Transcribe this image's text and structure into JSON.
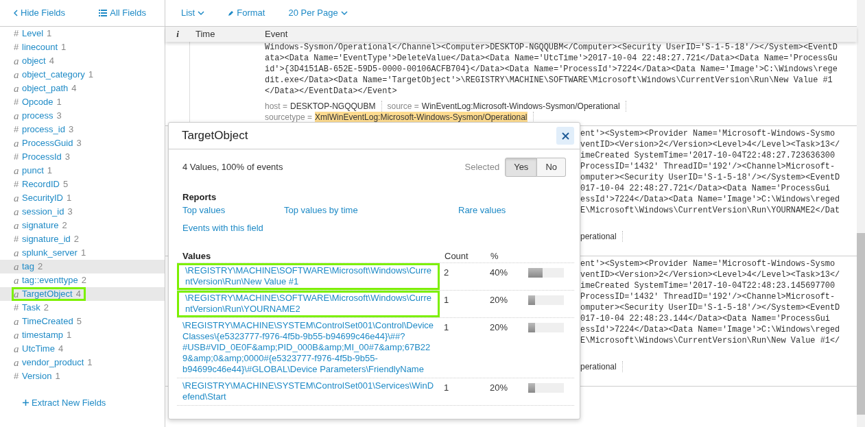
{
  "sidebar": {
    "hide_fields": "Hide Fields",
    "all_fields": "All Fields",
    "fields": [
      {
        "glyph": "#",
        "kind": "number",
        "name": "Level",
        "count": "1",
        "shaded": false,
        "outlined": false
      },
      {
        "glyph": "#",
        "kind": "number",
        "name": "linecount",
        "count": "1",
        "shaded": false,
        "outlined": false
      },
      {
        "glyph": "a",
        "kind": "string",
        "name": "object",
        "count": "4",
        "shaded": false,
        "outlined": false
      },
      {
        "glyph": "a",
        "kind": "string",
        "name": "object_category",
        "count": "1",
        "shaded": false,
        "outlined": false
      },
      {
        "glyph": "a",
        "kind": "string",
        "name": "object_path",
        "count": "4",
        "shaded": false,
        "outlined": false
      },
      {
        "glyph": "#",
        "kind": "number",
        "name": "Opcode",
        "count": "1",
        "shaded": false,
        "outlined": false
      },
      {
        "glyph": "a",
        "kind": "string",
        "name": "process",
        "count": "3",
        "shaded": false,
        "outlined": false
      },
      {
        "glyph": "#",
        "kind": "number",
        "name": "process_id",
        "count": "3",
        "shaded": false,
        "outlined": false
      },
      {
        "glyph": "a",
        "kind": "string",
        "name": "ProcessGuid",
        "count": "3",
        "shaded": false,
        "outlined": false
      },
      {
        "glyph": "#",
        "kind": "number",
        "name": "ProcessId",
        "count": "3",
        "shaded": false,
        "outlined": false
      },
      {
        "glyph": "a",
        "kind": "string",
        "name": "punct",
        "count": "1",
        "shaded": false,
        "outlined": false
      },
      {
        "glyph": "#",
        "kind": "number",
        "name": "RecordID",
        "count": "5",
        "shaded": false,
        "outlined": false
      },
      {
        "glyph": "a",
        "kind": "string",
        "name": "SecurityID",
        "count": "1",
        "shaded": false,
        "outlined": false
      },
      {
        "glyph": "a",
        "kind": "string",
        "name": "session_id",
        "count": "3",
        "shaded": false,
        "outlined": false
      },
      {
        "glyph": "a",
        "kind": "string",
        "name": "signature",
        "count": "2",
        "shaded": false,
        "outlined": false
      },
      {
        "glyph": "#",
        "kind": "number",
        "name": "signature_id",
        "count": "2",
        "shaded": false,
        "outlined": false
      },
      {
        "glyph": "a",
        "kind": "string",
        "name": "splunk_server",
        "count": "1",
        "shaded": false,
        "outlined": false
      },
      {
        "glyph": "a",
        "kind": "string",
        "name": "tag",
        "count": "2",
        "shaded": true,
        "outlined": false
      },
      {
        "glyph": "a",
        "kind": "string",
        "name": "tag::eventtype",
        "count": "2",
        "shaded": false,
        "outlined": false
      },
      {
        "glyph": "a",
        "kind": "string",
        "name": "TargetObject",
        "count": "4",
        "shaded": true,
        "outlined": true
      },
      {
        "glyph": "#",
        "kind": "number",
        "name": "Task",
        "count": "2",
        "shaded": false,
        "outlined": false
      },
      {
        "glyph": "a",
        "kind": "string",
        "name": "TimeCreated",
        "count": "5",
        "shaded": false,
        "outlined": false
      },
      {
        "glyph": "a",
        "kind": "string",
        "name": "timestamp",
        "count": "1",
        "shaded": false,
        "outlined": false
      },
      {
        "glyph": "a",
        "kind": "string",
        "name": "UtcTime",
        "count": "4",
        "shaded": false,
        "outlined": false
      },
      {
        "glyph": "a",
        "kind": "string",
        "name": "vendor_product",
        "count": "1",
        "shaded": false,
        "outlined": false
      },
      {
        "glyph": "#",
        "kind": "number",
        "name": "Version",
        "count": "1",
        "shaded": false,
        "outlined": false
      }
    ],
    "extract": "Extract New Fields"
  },
  "toolbar": [
    {
      "label": "List",
      "kind": "dropdown"
    },
    {
      "label": "Format",
      "kind": "edit"
    },
    {
      "label": "20 Per Page",
      "kind": "dropdown"
    }
  ],
  "table": {
    "columns": [
      "i",
      "Time",
      "Event"
    ],
    "events": [
      {
        "kind": "full",
        "lines": [
          "Windows-Sysmon/Operational</Channel><Computer>DESKTOP-NGQQUBM</Computer><Security UserID='S-1-5-18'/></System><EventD",
          "ata><Data Name='EventType'>DeleteValue</Data><Data Name='UtcTime'>2017-10-04 22:48:27.721</Data><Data Name='ProcessGu",
          "id'>{3D4151AB-652E-59D5-0000-00106ACFB704}</Data><Data Name='ProcessId'>7224</Data><Data Name='Image'>C:\\Windows\\rege",
          "dit.exe</Data><Data Name='TargetObject'>\\REGISTRY\\MACHINE\\SOFTWARE\\Microsoft\\Windows\\CurrentVersion\\Run\\New Value #1",
          "</Data></EventData></Event>"
        ],
        "meta": [
          {
            "key": "host =",
            "value": "DESKTOP-NGQQUBM",
            "highlighted": false
          },
          {
            "key": "source =",
            "value": "WinEventLog:Microsoft-Windows-Sysmon/Operational",
            "highlighted": false
          },
          {
            "key": "sourcetype =",
            "value": "XmlWinEventLog:Microsoft-Windows-Sysmon/Operational",
            "highlighted": true
          }
        ]
      },
      {
        "kind": "partial",
        "lines": [
          "ent'><System><Provider Name='Microsoft-Windows-Sysmo",
          "ventID><Version>2</Version><Level>4</Level><Task>13</",
          "imeCreated SystemTime='2017-10-04T22:48:27.723636300",
          "ProcessID='1432' ThreadID='192'/><Channel>Microsoft-",
          "omputer><Security UserID='S-1-5-18'/></System><EventD",
          "017-10-04 22:48:27.721</Data><Data Name='ProcessGui",
          "essId'>7224</Data><Data Name='Image'>C:\\Windows\\reged",
          "E\\Microsoft\\Windows\\CurrentVersion\\Run\\YOURNAME2</Dat"
        ],
        "meta": [
          {
            "value": "perational",
            "highlighted": false
          }
        ]
      },
      {
        "kind": "partial",
        "lines": [
          "ent'><System><Provider Name='Microsoft-Windows-Sysmo",
          "ventID><Version>2</Version><Level>4</Level><Task>13</",
          "imeCreated SystemTime='2017-10-04T22:48:23.145697700",
          "ProcessID='1432' ThreadID='192'/><Channel>Microsoft-",
          "omputer><Security UserID='S-1-5-18'/></System><EventD",
          "017-10-04 22:48:23.144</Data><Data Name='ProcessGui",
          "essId'>7224</Data><Data Name='Image'>C:\\Windows\\reged",
          "E\\Microsoft\\Windows\\CurrentVersion\\Run\\New Value #1</"
        ],
        "meta": [
          {
            "value": "perational",
            "highlighted": false
          }
        ]
      }
    ]
  },
  "popup": {
    "title": "TargetObject",
    "summary": "4 Values, 100% of events",
    "selected_label": "Selected",
    "options": [
      {
        "label": "Yes",
        "selected": true
      },
      {
        "label": "No",
        "selected": false
      }
    ],
    "reports_title": "Reports",
    "reports": [
      "Top values",
      "Top values by time",
      "Rare values",
      "Events with this field"
    ],
    "columns": [
      "Values",
      "Count",
      "%"
    ],
    "values": [
      {
        "value": "\\REGISTRY\\MACHINE\\SOFTWARE\\Microsoft\\Windows\\CurrentVersion\\Run\\New Value #1",
        "count": "2",
        "percent": "40%",
        "level": 0.4,
        "outlined": true
      },
      {
        "value": "\\REGISTRY\\MACHINE\\SOFTWARE\\Microsoft\\Windows\\CurrentVersion\\Run\\YOURNAME2",
        "count": "1",
        "percent": "20%",
        "level": 0.2,
        "outlined": true
      },
      {
        "value": "\\REGISTRY\\MACHINE\\SYSTEM\\ControlSet001\\Control\\DeviceClasses\\{e5323777-f976-4f5b-9b55-b94699c46e44}\\##?#USB#VID_0E0F&amp;PID_000B&amp;MI_00#7&amp;67B229&amp;0&amp;0000#{e5323777-f976-4f5b-9b55-b94699c46e44}\\#GLOBAL\\Device Parameters\\FriendlyName",
        "count": "1",
        "percent": "20%",
        "level": 0.2,
        "outlined": false
      },
      {
        "value": "\\REGISTRY\\MACHINE\\SYSTEM\\ControlSet001\\Services\\WinDefend\\Start",
        "count": "1",
        "percent": "20%",
        "level": 0.2,
        "outlined": false
      }
    ]
  }
}
